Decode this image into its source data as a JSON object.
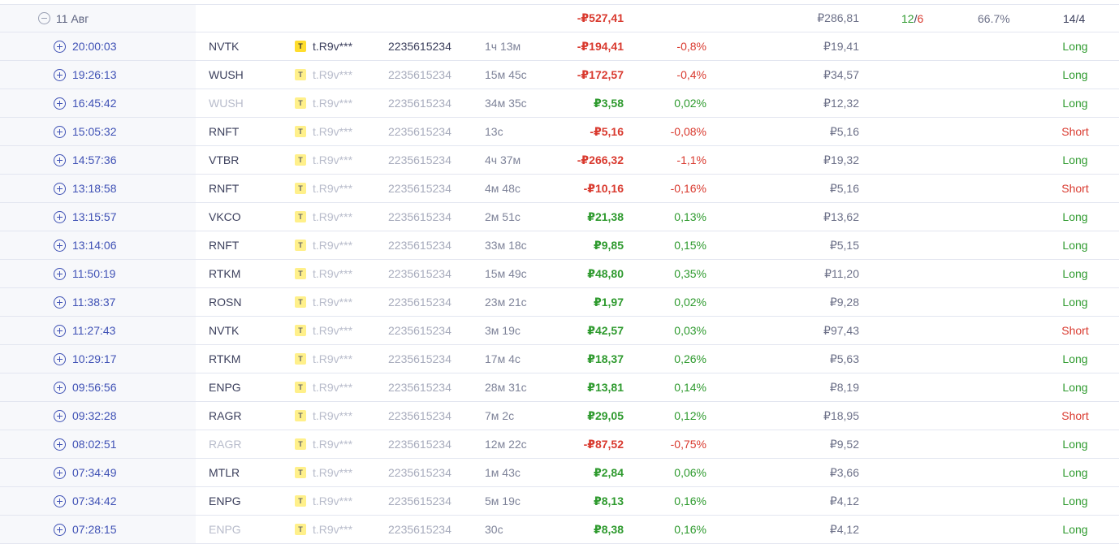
{
  "group": {
    "date": "11 Авг",
    "pnl": "-₽527,41",
    "fee": "₽286,81",
    "wins": "12",
    "losses": "6",
    "sep": "/",
    "winrate": "66.7%",
    "ratio": "14/4"
  },
  "trades": [
    {
      "time": "20:00:03",
      "ticker": "NVTK",
      "account": "t.R9v***",
      "accnum": "2235615234",
      "duration": "1ч 13м",
      "pnl": "-₽194,41",
      "pct": "-0,8%",
      "fee": "₽19,41",
      "side": "Long",
      "muted_ticker": false,
      "muted_acc": false
    },
    {
      "time": "19:26:13",
      "ticker": "WUSH",
      "account": "t.R9v***",
      "accnum": "2235615234",
      "duration": "15м 45с",
      "pnl": "-₽172,57",
      "pct": "-0,4%",
      "fee": "₽34,57",
      "side": "Long",
      "muted_ticker": false,
      "muted_acc": true
    },
    {
      "time": "16:45:42",
      "ticker": "WUSH",
      "account": "t.R9v***",
      "accnum": "2235615234",
      "duration": "34м 35с",
      "pnl": "₽3,58",
      "pct": "0,02%",
      "fee": "₽12,32",
      "side": "Long",
      "muted_ticker": true,
      "muted_acc": true
    },
    {
      "time": "15:05:32",
      "ticker": "RNFT",
      "account": "t.R9v***",
      "accnum": "2235615234",
      "duration": "13с",
      "pnl": "-₽5,16",
      "pct": "-0,08%",
      "fee": "₽5,16",
      "side": "Short",
      "muted_ticker": false,
      "muted_acc": true
    },
    {
      "time": "14:57:36",
      "ticker": "VTBR",
      "account": "t.R9v***",
      "accnum": "2235615234",
      "duration": "4ч 37м",
      "pnl": "-₽266,32",
      "pct": "-1,1%",
      "fee": "₽19,32",
      "side": "Long",
      "muted_ticker": false,
      "muted_acc": true
    },
    {
      "time": "13:18:58",
      "ticker": "RNFT",
      "account": "t.R9v***",
      "accnum": "2235615234",
      "duration": "4м 48с",
      "pnl": "-₽10,16",
      "pct": "-0,16%",
      "fee": "₽5,16",
      "side": "Short",
      "muted_ticker": false,
      "muted_acc": true
    },
    {
      "time": "13:15:57",
      "ticker": "VKCO",
      "account": "t.R9v***",
      "accnum": "2235615234",
      "duration": "2м 51с",
      "pnl": "₽21,38",
      "pct": "0,13%",
      "fee": "₽13,62",
      "side": "Long",
      "muted_ticker": false,
      "muted_acc": true
    },
    {
      "time": "13:14:06",
      "ticker": "RNFT",
      "account": "t.R9v***",
      "accnum": "2235615234",
      "duration": "33м 18с",
      "pnl": "₽9,85",
      "pct": "0,15%",
      "fee": "₽5,15",
      "side": "Long",
      "muted_ticker": false,
      "muted_acc": true
    },
    {
      "time": "11:50:19",
      "ticker": "RTKM",
      "account": "t.R9v***",
      "accnum": "2235615234",
      "duration": "15м 49с",
      "pnl": "₽48,80",
      "pct": "0,35%",
      "fee": "₽11,20",
      "side": "Long",
      "muted_ticker": false,
      "muted_acc": true
    },
    {
      "time": "11:38:37",
      "ticker": "ROSN",
      "account": "t.R9v***",
      "accnum": "2235615234",
      "duration": "23м 21с",
      "pnl": "₽1,97",
      "pct": "0,02%",
      "fee": "₽9,28",
      "side": "Long",
      "muted_ticker": false,
      "muted_acc": true
    },
    {
      "time": "11:27:43",
      "ticker": "NVTK",
      "account": "t.R9v***",
      "accnum": "2235615234",
      "duration": "3м 19с",
      "pnl": "₽42,57",
      "pct": "0,03%",
      "fee": "₽97,43",
      "side": "Short",
      "muted_ticker": false,
      "muted_acc": true
    },
    {
      "time": "10:29:17",
      "ticker": "RTKM",
      "account": "t.R9v***",
      "accnum": "2235615234",
      "duration": "17м 4с",
      "pnl": "₽18,37",
      "pct": "0,26%",
      "fee": "₽5,63",
      "side": "Long",
      "muted_ticker": false,
      "muted_acc": true
    },
    {
      "time": "09:56:56",
      "ticker": "ENPG",
      "account": "t.R9v***",
      "accnum": "2235615234",
      "duration": "28м 31с",
      "pnl": "₽13,81",
      "pct": "0,14%",
      "fee": "₽8,19",
      "side": "Long",
      "muted_ticker": false,
      "muted_acc": true
    },
    {
      "time": "09:32:28",
      "ticker": "RAGR",
      "account": "t.R9v***",
      "accnum": "2235615234",
      "duration": "7м 2с",
      "pnl": "₽29,05",
      "pct": "0,12%",
      "fee": "₽18,95",
      "side": "Short",
      "muted_ticker": false,
      "muted_acc": true
    },
    {
      "time": "08:02:51",
      "ticker": "RAGR",
      "account": "t.R9v***",
      "accnum": "2235615234",
      "duration": "12м 22с",
      "pnl": "-₽87,52",
      "pct": "-0,75%",
      "fee": "₽9,52",
      "side": "Long",
      "muted_ticker": true,
      "muted_acc": true
    },
    {
      "time": "07:34:49",
      "ticker": "MTLR",
      "account": "t.R9v***",
      "accnum": "2235615234",
      "duration": "1м 43с",
      "pnl": "₽2,84",
      "pct": "0,06%",
      "fee": "₽3,66",
      "side": "Long",
      "muted_ticker": false,
      "muted_acc": true
    },
    {
      "time": "07:34:42",
      "ticker": "ENPG",
      "account": "t.R9v***",
      "accnum": "2235615234",
      "duration": "5м 19с",
      "pnl": "₽8,13",
      "pct": "0,16%",
      "fee": "₽4,12",
      "side": "Long",
      "muted_ticker": false,
      "muted_acc": true
    },
    {
      "time": "07:28:15",
      "ticker": "ENPG",
      "account": "t.R9v***",
      "accnum": "2235615234",
      "duration": "30с",
      "pnl": "₽8,38",
      "pct": "0,16%",
      "fee": "₽4,12",
      "side": "Long",
      "muted_ticker": true,
      "muted_acc": true
    }
  ],
  "icons": {
    "broker": "tinkoff-logo-icon",
    "expand": "plus-circle-icon",
    "collapse": "minus-circle-icon",
    "broker_letter": "T"
  },
  "colors": {
    "accent": "#3f51b5",
    "positive": "#2e9a2e",
    "negative": "#d93a2f",
    "broker": "#ffdd2d"
  }
}
